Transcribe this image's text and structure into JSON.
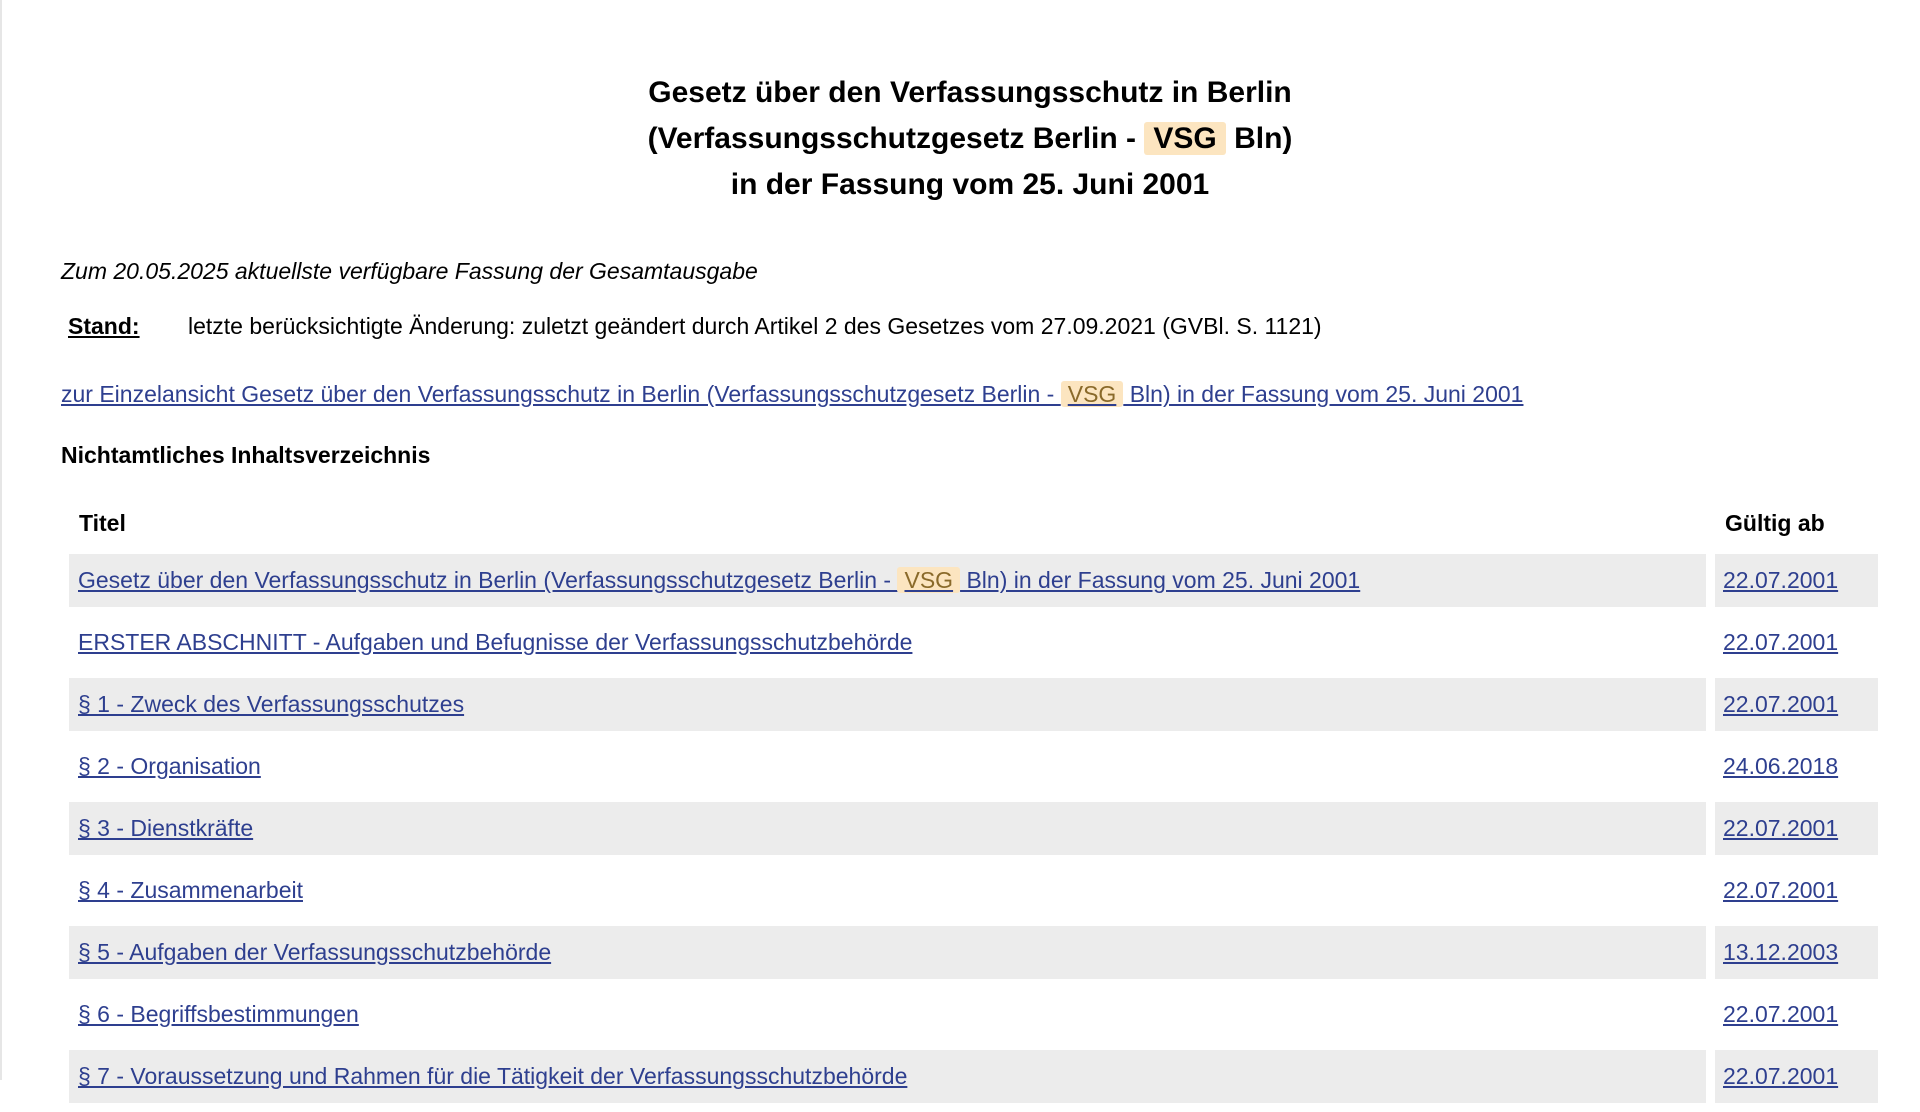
{
  "document": {
    "title_line1": "Gesetz über den Verfassungsschutz in Berlin",
    "title_line2_prefix": "(Verfassungsschutzgesetz Berlin - ",
    "title_line2_highlight": "VSG",
    "title_line2_suffix": " Bln)",
    "title_line3": "in der Fassung vom 25. Juni 2001",
    "version_note": "Zum 20.05.2025 aktuellste verfügbare Fassung der Gesamtausgabe",
    "stand_label": "Stand:",
    "stand_text": "letzte berücksichtigte Änderung: zuletzt geändert durch Artikel 2 des Gesetzes vom 27.09.2021 (GVBl. S. 1121)",
    "single_view_prefix": "zur Einzelansicht Gesetz über den Verfassungsschutz in Berlin (Verfassungsschutzgesetz Berlin - ",
    "single_view_highlight": "VSG",
    "single_view_suffix": " Bln) in der Fassung vom 25. Juni 2001"
  },
  "toc": {
    "heading": "Nichtamtliches Inhaltsverzeichnis",
    "col_title": "Titel",
    "col_valid_from": "Gültig ab",
    "first_row": {
      "title_prefix": "Gesetz über den Verfassungsschutz in Berlin (Verfassungsschutzgesetz Berlin - ",
      "title_highlight": "VSG",
      "title_suffix": " Bln) in der Fassung vom 25. Juni 2001",
      "date": "22.07.2001"
    },
    "rows": [
      {
        "title": "ERSTER ABSCHNITT - Aufgaben und Befugnisse der Verfassungsschutzbehörde",
        "date": "22.07.2001"
      },
      {
        "title": "§ 1 - Zweck des Verfassungsschutzes",
        "date": "22.07.2001"
      },
      {
        "title": "§ 2 - Organisation",
        "date": "24.06.2018"
      },
      {
        "title": "§ 3 - Dienstkräfte",
        "date": "22.07.2001"
      },
      {
        "title": "§ 4 - Zusammenarbeit",
        "date": "22.07.2001"
      },
      {
        "title": "§ 5 - Aufgaben der Verfassungsschutzbehörde",
        "date": "13.12.2003"
      },
      {
        "title": "§ 6 - Begriffsbestimmungen",
        "date": "22.07.2001"
      },
      {
        "title": "§ 7 - Voraussetzung und Rahmen für die Tätigkeit der Verfassungsschutzbehörde",
        "date": "22.07.2001"
      }
    ]
  }
}
